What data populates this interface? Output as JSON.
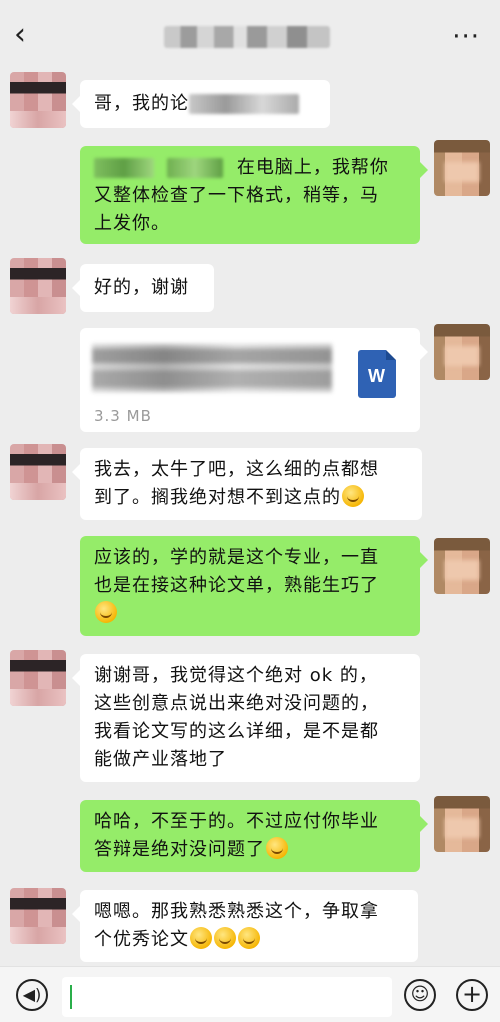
{
  "header": {
    "back_symbol": "‹",
    "more_symbol": "···"
  },
  "messages": [
    {
      "side": "left",
      "text_visible": "哥，我的论"
    },
    {
      "side": "right",
      "line1": "在电脑上，我帮你",
      "line2": "又整体检查了一下格式，稍等，马",
      "line3": "上发你。"
    },
    {
      "side": "left",
      "text": "好的，谢谢"
    },
    {
      "side": "right",
      "type": "file",
      "file_size": "3.3 MB",
      "file_icon_letter": "W"
    },
    {
      "side": "left",
      "line1": "我去，太牛了吧，这么细的点都想",
      "line2": "到了。搁我绝对想不到这点的"
    },
    {
      "side": "right",
      "line1": "应该的，学的就是这个专业，一直",
      "line2": "也是在接这种论文单，熟能生巧了"
    },
    {
      "side": "left",
      "line1": "谢谢哥，我觉得这个绝对 ok 的，",
      "line2": "这些创意点说出来绝对没问题的，",
      "line3": "我看论文写的这么详细，是不是都",
      "line4": "能做产业落地了"
    },
    {
      "side": "right",
      "line1": "哈哈，不至于的。不过应付你毕业",
      "line2": "答辩是绝对没问题了"
    },
    {
      "side": "left",
      "line1": "嗯嗯。那我熟悉熟悉这个，争取拿",
      "line2": "个优秀论文"
    }
  ],
  "input_bar": {
    "voice_symbol": "◀)",
    "emoji_symbol": "☺",
    "plus_symbol": "+"
  },
  "colors": {
    "background": "#ededed",
    "sent_bubble": "#95ec69",
    "received_bubble": "#ffffff",
    "word_blue": "#2f62b4"
  }
}
